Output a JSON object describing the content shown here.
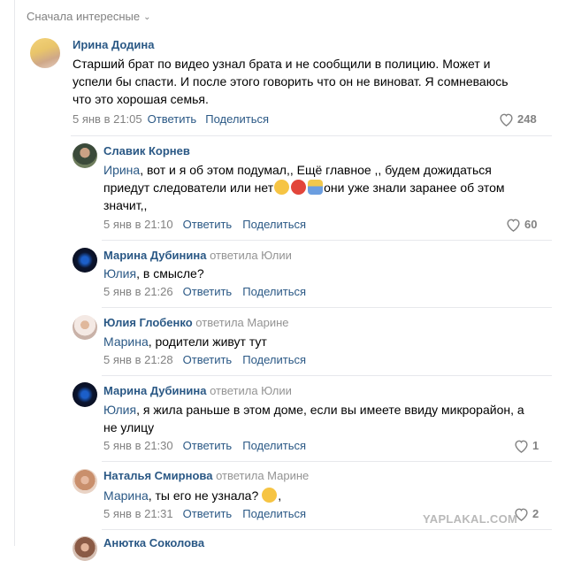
{
  "sort_label": "Сначала интересные",
  "comments": [
    {
      "author": "Ирина Додина",
      "replied": "",
      "mention": "",
      "text": "Старший брат по видео узнал брата и не сообщили в полицию. Может и успели бы спасти. И после этого говорить что он не виноват. Я сомневаюсь что это хорошая семья.",
      "time": "5 янв в 21:05",
      "reply": "Ответить",
      "share": "Поделиться",
      "likes": "248"
    },
    {
      "author": "Славик Корнев",
      "replied": "",
      "mention": "Ирина",
      "text_a": ", вот и я об этом подумал,, Ещё главное ,, будем дожидаться приедут следователи или нет",
      "text_b": "они уже знали заранее об этом значит,,",
      "time": "5 янв в 21:10",
      "reply": "Ответить",
      "share": "Поделиться",
      "likes": "60"
    },
    {
      "author": "Марина Дубинина",
      "replied": "ответила Юлии",
      "mention": "Юлия",
      "text": ", в смысле?",
      "time": "5 янв в 21:26",
      "reply": "Ответить",
      "share": "Поделиться",
      "likes": ""
    },
    {
      "author": "Юлия Глобенко",
      "replied": "ответила Марине",
      "mention": "Марина",
      "text": ", родители живут тут",
      "time": "5 янв в 21:28",
      "reply": "Ответить",
      "share": "Поделиться",
      "likes": ""
    },
    {
      "author": "Марина Дубинина",
      "replied": "ответила Юлии",
      "mention": "Юлия",
      "text": ", я жила раньше в этом доме, если вы имеете ввиду микрорайон, а не улицу",
      "time": "5 янв в 21:30",
      "reply": "Ответить",
      "share": "Поделиться",
      "likes": "1"
    },
    {
      "author": "Наталья Смирнова",
      "replied": "ответила Марине",
      "mention": "Марина",
      "text": ", ты его не узнала?",
      "text_after": ",",
      "time": "5 янв в 21:31",
      "reply": "Ответить",
      "share": "Поделиться",
      "likes": "2"
    },
    {
      "author": "Анютка Соколова"
    }
  ],
  "watermark": "YAPLAKAL.COM",
  "colors": {
    "link": "#2a5885",
    "meta": "#828282",
    "separator": "#e7e8ec"
  }
}
